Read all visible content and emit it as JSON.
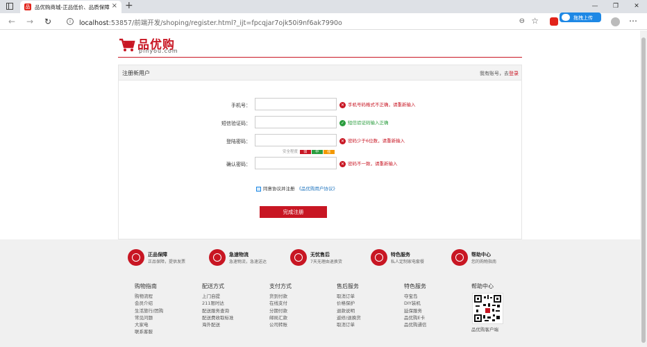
{
  "browser": {
    "tab_title": "品优购商城-正品低价、品质保障",
    "tab_close": "×",
    "new_tab": "+",
    "url_host": "localhost",
    "url_rest": ":53857/前端开发/shoping/register.html?_ijt=fpcqjar7ojk50i9nf6ak7990o",
    "upload_label": "拖拽上传",
    "win_min": "—",
    "win_max": "❐",
    "win_close": "✕"
  },
  "logo": {
    "cn": "品优购",
    "en": "pinyou.com"
  },
  "register": {
    "title": "注册新用户",
    "have_account": "我有账号，去",
    "login_link": "登录",
    "fields": [
      {
        "label": "手机号：",
        "message": "手机号码格式不正确，请重新输入",
        "status": "error"
      },
      {
        "label": "短信验证码：",
        "message": "短信验证码输入正确",
        "status": "ok"
      },
      {
        "label": "登陆密码：",
        "message": "密码少于6位数，请重新输入",
        "status": "error"
      },
      {
        "label": "确认密码：",
        "message": "密码不一致，请重新输入",
        "status": "error"
      }
    ],
    "strength_label": "安全程度",
    "strength_levels": [
      "弱",
      "中",
      "强"
    ],
    "agree_text": "同意协议并注册",
    "agree_link": "《品优购用户协议》",
    "submit": "完成注册"
  },
  "colors": {
    "brand": "#c81623",
    "ok": "#2a9d3e",
    "strength_weak": "#c81623",
    "strength_mid": "#2a9d3e",
    "strength_strong": "#f39800"
  },
  "footer": {
    "services": [
      {
        "icon": "shield-icon",
        "title": "正品保障",
        "sub": "正品保障，提供发票"
      },
      {
        "icon": "truck-icon",
        "title": "急速物流",
        "sub": "急速物流，急速送达"
      },
      {
        "icon": "return-icon",
        "title": "无忧售后",
        "sub": "7天无理由退换货"
      },
      {
        "icon": "badge-icon",
        "title": "特色服务",
        "sub": "私人定制家电套餐"
      },
      {
        "icon": "help-icon",
        "title": "帮助中心",
        "sub": "您的购物指南"
      }
    ],
    "columns": [
      {
        "title": "购物指南",
        "items": [
          "购物流程",
          "会员介绍",
          "生活旅行/团购",
          "常见问题",
          "大家电",
          "联系客服"
        ]
      },
      {
        "title": "配送方式",
        "items": [
          "上门自提",
          "211限时达",
          "配送服务查询",
          "配送费收取标准",
          "海外配送"
        ]
      },
      {
        "title": "支付方式",
        "items": [
          "货到付款",
          "在线支付",
          "分期付款",
          "邮局汇款",
          "公司转账"
        ]
      },
      {
        "title": "售后服务",
        "items": [
          "取消订单",
          "价格保护",
          "退款说明",
          "返修/退换货",
          "取消订单"
        ]
      },
      {
        "title": "特色服务",
        "items": [
          "夺宝岛",
          "DIY装机",
          "延保服务",
          "品优购E卡",
          "品优购通信"
        ]
      }
    ],
    "qr_title": "帮助中心",
    "qr_caption": "品优购客户端"
  }
}
